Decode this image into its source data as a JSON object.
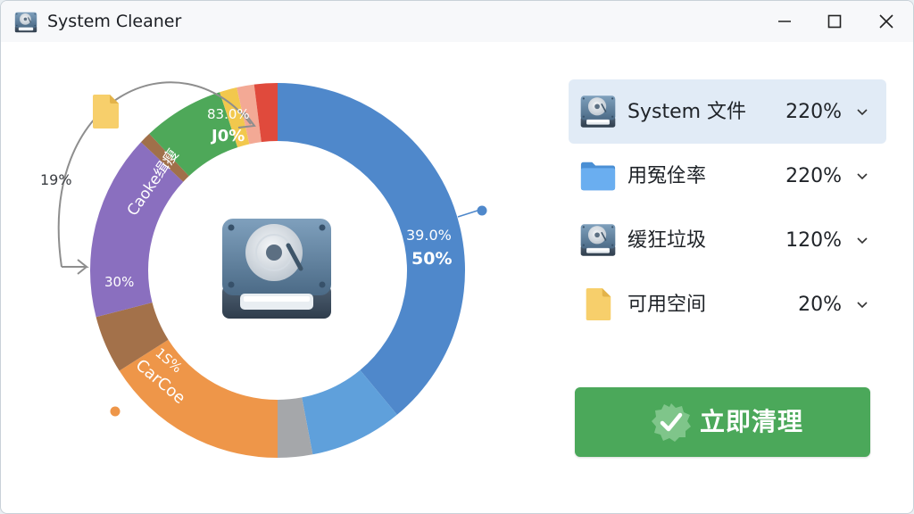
{
  "window": {
    "title": "System Cleaner",
    "app_icon": "hard-drive-icon",
    "controls": [
      "minimize-icon",
      "maximize-icon",
      "close-icon"
    ]
  },
  "donut": {
    "center_icon": "hard-drive-icon",
    "segments": [
      {
        "color": "#4f88cb",
        "value": 39.0
      },
      {
        "color": "#5fa0db",
        "value": 8.0
      },
      {
        "color": "#a5a7aa",
        "value": 3.0
      },
      {
        "color": "#ee9649",
        "value": 16.0
      },
      {
        "color": "#a3714a",
        "value": 5.0
      },
      {
        "color": "#8a6fbf",
        "value": 16.0
      },
      {
        "color": "#a0704a",
        "value": 1.0
      },
      {
        "color": "#4ea859",
        "value": 7.0
      },
      {
        "color": "#f2c84d",
        "value": 1.5
      },
      {
        "color": "#f3a995",
        "value": 1.5
      },
      {
        "color": "#e04a3c",
        "value": 2.0
      }
    ],
    "labels": {
      "blue_line1": "39.0%",
      "blue_line2": "50%",
      "green_line1": "83.0%",
      "green_line2": "J0%",
      "purple": "Caoke缉瘦",
      "brown": "30%",
      "orange_line1": "1S%",
      "orange_line2": "CarCoe",
      "outer_pct": "19%"
    },
    "decor_icons": [
      "file-icon"
    ]
  },
  "categories": [
    {
      "icon": "hard-drive-icon",
      "label": "System 文件",
      "value": "220%",
      "selected": true
    },
    {
      "icon": "folder-icon",
      "label": "用冤佺率",
      "value": "220%",
      "selected": false
    },
    {
      "icon": "hard-drive-icon",
      "label": "缓狂垃圾",
      "value": "120%",
      "selected": false
    },
    {
      "icon": "file-icon",
      "label": "可用空间",
      "value": "20%",
      "selected": false
    }
  ],
  "clean_button": {
    "label": "立即清理",
    "icon": "verified-check-icon",
    "color": "#4ba85a"
  }
}
